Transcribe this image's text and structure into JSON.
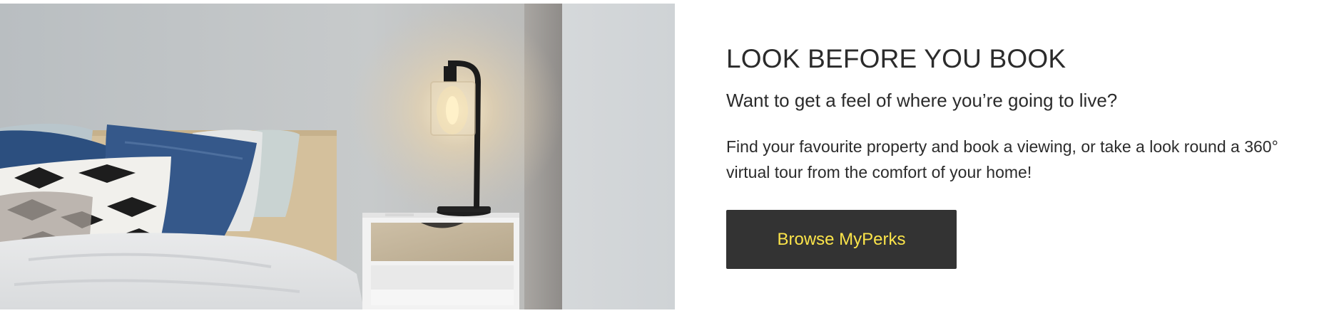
{
  "promo": {
    "heading": "LOOK BEFORE YOU BOOK",
    "subheading": "Want to get a feel of where you’re going to live?",
    "body": "Find your favourite property and book a viewing, or take a look round a 360° virtual tour from the comfort of your home!",
    "cta_label": "Browse MyPerks"
  },
  "colors": {
    "button_bg": "#333333",
    "button_text": "#fbe44a",
    "text": "#2b2b2b"
  }
}
